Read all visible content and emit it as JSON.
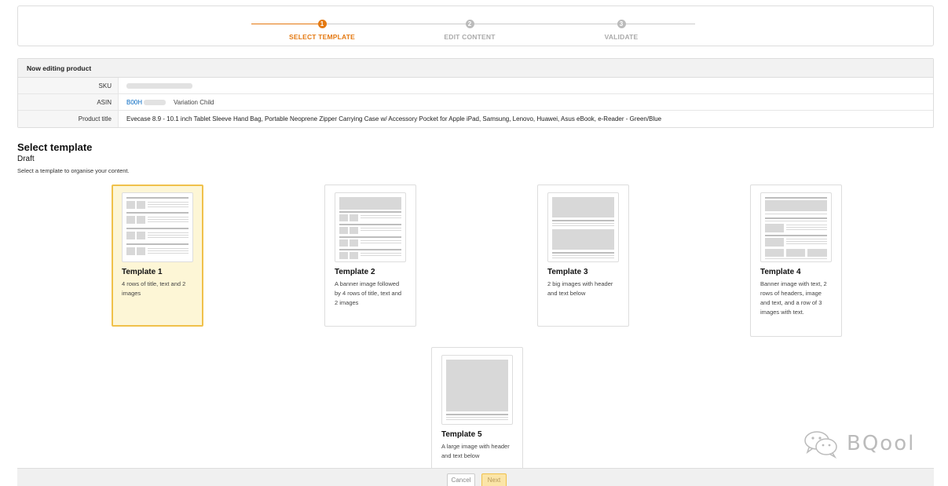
{
  "stepper": {
    "steps": [
      {
        "number": "1",
        "label": "SELECT TEMPLATE",
        "active": true
      },
      {
        "number": "2",
        "label": "EDIT CONTENT",
        "active": false
      },
      {
        "number": "3",
        "label": "VALIDATE",
        "active": false
      }
    ]
  },
  "product": {
    "heading": "Now editing product",
    "sku_label": "SKU",
    "asin_label": "ASIN",
    "asin_value": "B00H",
    "asin_variation": "Variation Child",
    "title_label": "Product title",
    "title_value": "Evecase 8.9 - 10.1 inch Tablet Sleeve Hand Bag, Portable Neoprene Zipper Carrying Case w/ Accessory Pocket for Apple iPad, Samsung, Lenovo, Huawei, Asus eBook, e-Reader - Green/Blue"
  },
  "select": {
    "title": "Select template",
    "status": "Draft",
    "description": "Select a template to organise your content."
  },
  "templates": [
    {
      "title": "Template 1",
      "desc": "4 rows of title, text and 2 images",
      "selected": true
    },
    {
      "title": "Template 2",
      "desc": "A banner image followed by 4 rows of title, text and 2 images",
      "selected": false
    },
    {
      "title": "Template 3",
      "desc": "2 big images with header and text below",
      "selected": false
    },
    {
      "title": "Template 4",
      "desc": "Banner image with text, 2 rows of headers, image and text, and a row of 3 images with text.",
      "selected": false
    },
    {
      "title": "Template 5",
      "desc": "A large image with header and text below",
      "selected": false
    }
  ],
  "footer": {
    "cancel_label": "Cancel",
    "next_label": "Next"
  },
  "watermark": {
    "text": "BQool"
  },
  "colors": {
    "accent": "#e47911",
    "selected_bg": "#fdf6d6",
    "selected_border": "#f0c14b",
    "link": "#0066c0"
  }
}
